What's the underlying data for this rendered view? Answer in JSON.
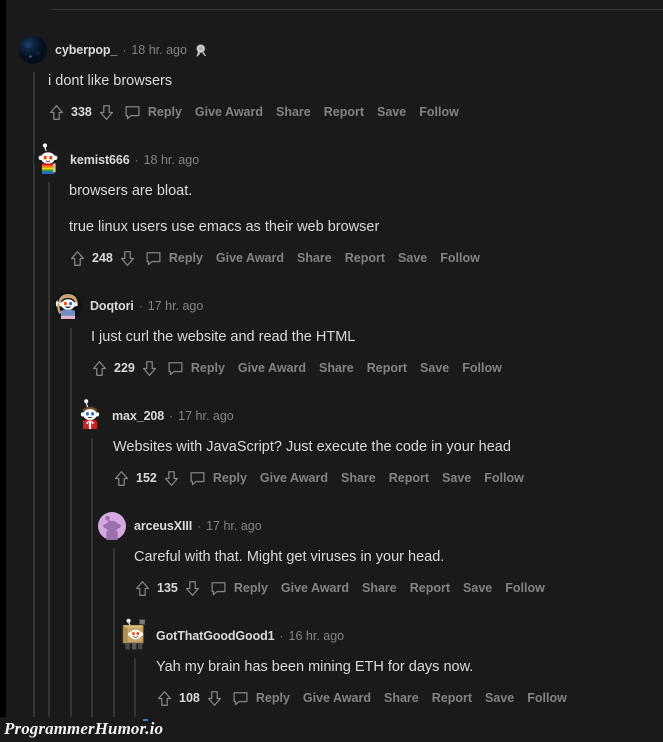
{
  "watermark": "ProgrammerHumor.io",
  "theme": {
    "background": "#1a1a1b",
    "text": "#d7dadc",
    "muted": "#818384",
    "thread_line": "#343536"
  },
  "icons": {
    "upvote": "upvote-arrow-icon",
    "downvote": "downvote-arrow-icon",
    "comment": "comment-bubble-icon",
    "award": "silver-award-icon"
  },
  "action_labels": [
    "Reply",
    "Give Award",
    "Share",
    "Report",
    "Save",
    "Follow"
  ],
  "comments": [
    {
      "username": "cyberpop_",
      "timestamp": "18 hr. ago",
      "score": "338",
      "has_award": true,
      "depth": 0,
      "avatar": "dark-blue-planet-avatar",
      "paragraphs": [
        "i dont like browsers"
      ],
      "actions": [
        "Reply",
        "Give Award",
        "Share",
        "Report",
        "Save",
        "Follow"
      ]
    },
    {
      "username": "kemist666",
      "timestamp": "18 hr. ago",
      "score": "248",
      "has_award": false,
      "depth": 1,
      "avatar": "snoo-rainbow-shirt-avatar",
      "paragraphs": [
        "browsers are bloat.",
        "true linux users use emacs as their web browser"
      ],
      "actions": [
        "Reply",
        "Give Award",
        "Share",
        "Report",
        "Save",
        "Follow"
      ]
    },
    {
      "username": "Doqtori",
      "timestamp": "17 hr. ago",
      "score": "229",
      "has_award": false,
      "depth": 2,
      "avatar": "snoo-long-hair-blue-shirt-avatar",
      "paragraphs": [
        "I just curl the website and read the HTML"
      ],
      "actions": [
        "Reply",
        "Give Award",
        "Share",
        "Report",
        "Save",
        "Follow"
      ]
    },
    {
      "username": "max_208",
      "timestamp": "17 hr. ago",
      "score": "152",
      "has_award": false,
      "depth": 3,
      "avatar": "snoo-red-jacket-avatar",
      "paragraphs": [
        "Websites with JavaScript? Just execute the code in your head"
      ],
      "actions": [
        "Reply",
        "Give Award",
        "Share",
        "Report",
        "Save",
        "Follow"
      ]
    },
    {
      "username": "arceusXIII",
      "timestamp": "17 hr. ago",
      "score": "135",
      "has_award": false,
      "depth": 4,
      "avatar": "purple-snoo-silhouette-avatar",
      "paragraphs": [
        "Careful with that. Might get viruses in your head."
      ],
      "actions": [
        "Reply",
        "Give Award",
        "Share",
        "Report",
        "Save",
        "Follow"
      ]
    },
    {
      "username": "GotThatGoodGood1",
      "timestamp": "16 hr. ago",
      "score": "108",
      "has_award": false,
      "depth": 5,
      "avatar": "snoo-cardboard-box-avatar",
      "paragraphs": [
        "Yah my brain has been mining ETH for days now."
      ],
      "actions": [
        "Reply",
        "Give Award",
        "Share",
        "Report",
        "Save",
        "Follow"
      ]
    }
  ]
}
